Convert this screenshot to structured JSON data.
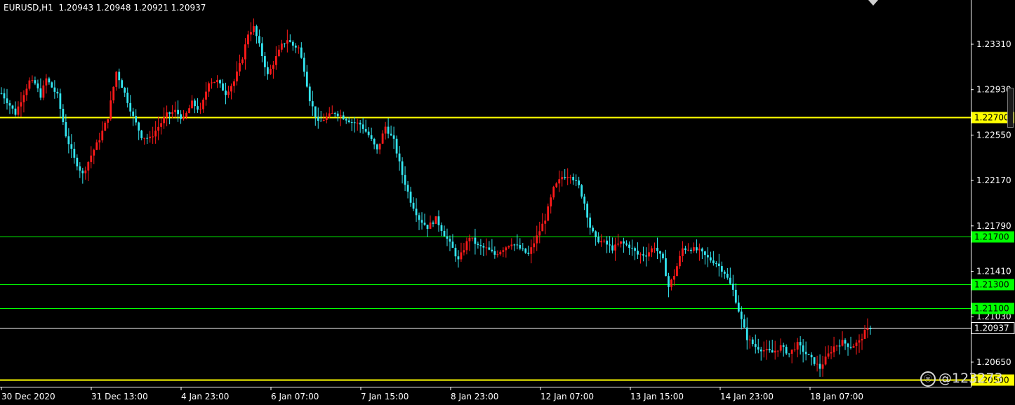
{
  "header": {
    "symbol": "EURUSD,H1",
    "ohlc": "1.20943 1.20948 1.20921 1.20937"
  },
  "watermark": {
    "icon": "weibo-icon",
    "text": "@123273"
  },
  "chart_data": {
    "type": "candlestick",
    "title": "EURUSD,H1",
    "ylim": [
      1.2045,
      1.2368
    ],
    "grid": false,
    "colors": {
      "background": "#000000",
      "bull": "#ff1a1a",
      "bear": "#33e5f0",
      "axis": "#ffffff"
    },
    "y_ticks": [
      "1.23310",
      "1.22930",
      "1.22550",
      "1.22170",
      "1.21790",
      "1.21410",
      "1.21030",
      "1.20650"
    ],
    "x_ticks": [
      "30 Dec 2020",
      "31 Dec 13:00",
      "4 Jan 23:00",
      "6 Jan 07:00",
      "7 Jan 15:00",
      "8 Jan 23:00",
      "12 Jan 07:00",
      "13 Jan 15:00",
      "14 Jan 23:00",
      "18 Jan 07:00"
    ],
    "levels": [
      {
        "price": 1.227,
        "label": "1.22700",
        "color": "#ffff00"
      },
      {
        "price": 1.217,
        "label": "1.21700",
        "color": "#00ff00"
      },
      {
        "price": 1.213,
        "label": "1.21300",
        "color": "#00ff00"
      },
      {
        "price": 1.211,
        "label": "1.21100",
        "color": "#00ff00"
      },
      {
        "price": 1.205,
        "label": "1.20500",
        "color": "#ffff00"
      }
    ],
    "current_price": {
      "price": 1.20937,
      "label": "1.20937",
      "color": "#ffffff"
    },
    "close_path": [
      [
        0,
        1.229
      ],
      [
        3,
        1.228
      ],
      [
        5,
        1.2273
      ],
      [
        8,
        1.229
      ],
      [
        10,
        1.23
      ],
      [
        12,
        1.2298
      ],
      [
        14,
        1.2288
      ],
      [
        16,
        1.2302
      ],
      [
        18,
        1.2295
      ],
      [
        20,
        1.2288
      ],
      [
        23,
        1.2255
      ],
      [
        26,
        1.2235
      ],
      [
        29,
        1.2222
      ],
      [
        32,
        1.2238
      ],
      [
        35,
        1.2252
      ],
      [
        38,
        1.227
      ],
      [
        41,
        1.2308
      ],
      [
        44,
        1.229
      ],
      [
        47,
        1.227
      ],
      [
        50,
        1.2254
      ],
      [
        53,
        1.2252
      ],
      [
        56,
        1.2262
      ],
      [
        59,
        1.2272
      ],
      [
        62,
        1.2275
      ],
      [
        65,
        1.2268
      ],
      [
        68,
        1.2282
      ],
      [
        71,
        1.2275
      ],
      [
        74,
        1.23
      ],
      [
        77,
        1.23
      ],
      [
        80,
        1.229
      ],
      [
        83,
        1.23
      ],
      [
        86,
        1.232
      ],
      [
        88,
        1.234
      ],
      [
        90,
        1.2345
      ],
      [
        92,
        1.233
      ],
      [
        95,
        1.2305
      ],
      [
        97,
        1.2315
      ],
      [
        100,
        1.233
      ],
      [
        102,
        1.2335
      ],
      [
        104,
        1.233
      ],
      [
        106,
        1.2328
      ],
      [
        108,
        1.231
      ],
      [
        110,
        1.2285
      ],
      [
        113,
        1.2265
      ],
      [
        116,
        1.227
      ],
      [
        119,
        1.2274
      ],
      [
        122,
        1.227
      ],
      [
        125,
        1.2266
      ],
      [
        128,
        1.2264
      ],
      [
        131,
        1.2255
      ],
      [
        134,
        1.2242
      ],
      [
        137,
        1.2262
      ],
      [
        140,
        1.225
      ],
      [
        143,
        1.2222
      ],
      [
        146,
        1.22
      ],
      [
        149,
        1.2185
      ],
      [
        152,
        1.2178
      ],
      [
        155,
        1.2185
      ],
      [
        158,
        1.2172
      ],
      [
        161,
        1.216
      ],
      [
        163,
        1.215
      ],
      [
        165,
        1.216
      ],
      [
        167,
        1.217
      ],
      [
        170,
        1.2162
      ],
      [
        173,
        1.216
      ],
      [
        176,
        1.2155
      ],
      [
        179,
        1.216
      ],
      [
        182,
        1.2165
      ],
      [
        185,
        1.216
      ],
      [
        188,
        1.2155
      ],
      [
        191,
        1.217
      ],
      [
        194,
        1.2185
      ],
      [
        197,
        1.221
      ],
      [
        200,
        1.222
      ],
      [
        203,
        1.2222
      ],
      [
        206,
        1.2212
      ],
      [
        208,
        1.2198
      ],
      [
        210,
        1.2178
      ],
      [
        212,
        1.2168
      ],
      [
        215,
        1.2165
      ],
      [
        218,
        1.216
      ],
      [
        221,
        1.2165
      ],
      [
        224,
        1.2162
      ],
      [
        227,
        1.2155
      ],
      [
        230,
        1.2155
      ],
      [
        233,
        1.2162
      ],
      [
        236,
        1.215
      ],
      [
        238,
        1.2128
      ],
      [
        240,
        1.2138
      ],
      [
        243,
        1.216
      ],
      [
        246,
        1.216
      ],
      [
        249,
        1.2158
      ],
      [
        252,
        1.2152
      ],
      [
        255,
        1.2148
      ],
      [
        258,
        1.214
      ],
      [
        261,
        1.2125
      ],
      [
        264,
        1.21
      ],
      [
        266,
        1.2085
      ],
      [
        269,
        1.2078
      ],
      [
        272,
        1.2075
      ],
      [
        275,
        1.2073
      ],
      [
        278,
        1.2078
      ],
      [
        281,
        1.2072
      ],
      [
        284,
        1.208
      ],
      [
        287,
        1.2072
      ],
      [
        290,
        1.2065
      ],
      [
        292,
        1.206
      ],
      [
        294,
        1.2068
      ],
      [
        297,
        1.2078
      ],
      [
        300,
        1.2082
      ],
      [
        303,
        1.2078
      ],
      [
        306,
        1.2082
      ],
      [
        308,
        1.209
      ],
      [
        310,
        1.2094
      ]
    ]
  }
}
